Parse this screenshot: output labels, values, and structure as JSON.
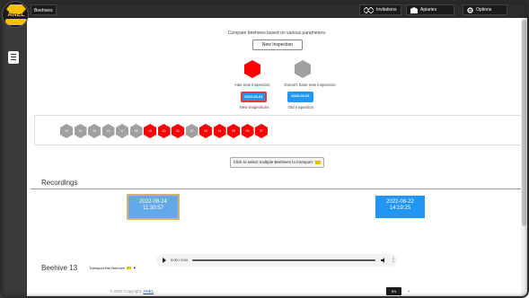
{
  "header": {
    "logo_text": "ANEL",
    "page_title": "Beehives",
    "nav": [
      {
        "label": "Invitations",
        "icon": "network-icon"
      },
      {
        "label": "Apiaries",
        "icon": "apiary-icon"
      },
      {
        "label": "Options",
        "icon": "gear-icon"
      }
    ]
  },
  "compare": {
    "text": "Compare beehives based on various parameters:",
    "new_inspection_button": "New Inspection"
  },
  "legend": {
    "has_new": "Has new inspection",
    "no_new": "Doesn't have new inspection",
    "new_date": "2022-01-01",
    "old_date": "2022-01-01",
    "new_label": "New Inspections",
    "old_label": "Old Inspection",
    "has_new_color": "#ff0000",
    "no_new_color": "#a0a0a0"
  },
  "hives": [
    {
      "label": "13",
      "status": "grey"
    },
    {
      "label": "14",
      "status": "grey"
    },
    {
      "label": "15",
      "status": "grey"
    },
    {
      "label": "16",
      "status": "grey"
    },
    {
      "label": "17",
      "status": "grey"
    },
    {
      "label": "18",
      "status": "grey"
    },
    {
      "label": "19",
      "status": "red"
    },
    {
      "label": "20",
      "status": "red"
    },
    {
      "label": "21",
      "status": "red"
    },
    {
      "label": "22",
      "status": "grey"
    },
    {
      "label": "23",
      "status": "red"
    },
    {
      "label": "24",
      "status": "red"
    },
    {
      "label": "25",
      "status": "red"
    },
    {
      "label": "26",
      "status": "red"
    },
    {
      "label": "27",
      "status": "red"
    }
  ],
  "transport": {
    "multi_button": "Click to select multiple Beehives to transport"
  },
  "recordings": {
    "title": "Recordings",
    "cards": [
      {
        "date": "2022-08-24",
        "time": "11:30:57",
        "selected": true
      },
      {
        "date": "2022-08-22",
        "time": "14:19:25",
        "selected": false
      }
    ],
    "audio_time": "0:00 / 0:04"
  },
  "beehive": {
    "title": "Beehive 13",
    "transport_button": "Transport this Beehive"
  },
  "footer": {
    "copyright": "© 2022 Copyright:",
    "link": "ANEL",
    "language": "EN"
  },
  "colors": {
    "accent_blue": "#2196f3",
    "hive_red": "#ff0000",
    "hive_grey": "#a0a0a0",
    "topbar": "#2d2d2d"
  }
}
